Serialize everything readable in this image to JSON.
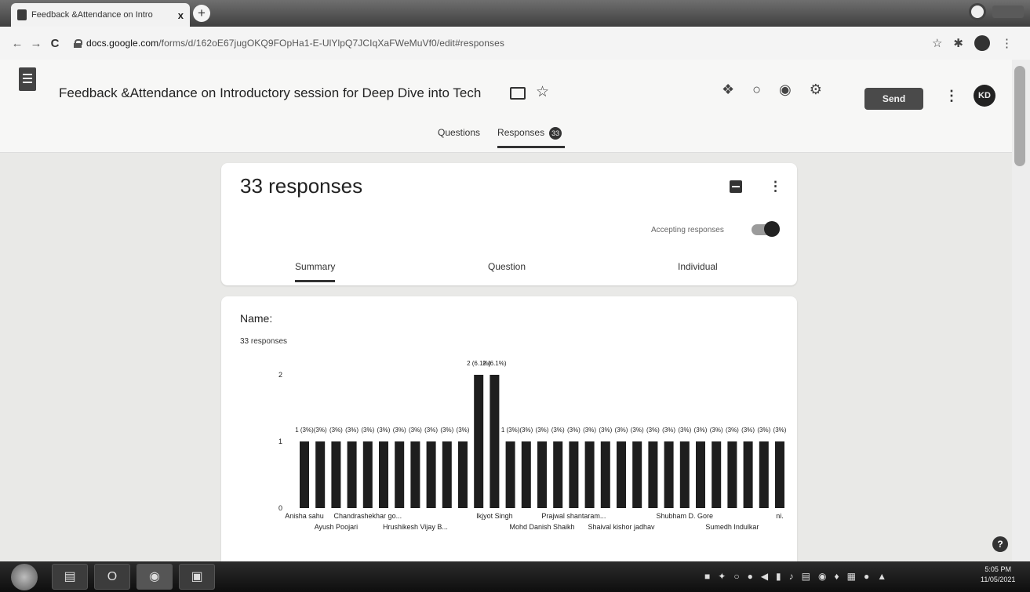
{
  "browser": {
    "tab_title": "Feedback &Attendance on Intro",
    "tab_close": "x",
    "new_tab": "+",
    "url_host": "docs.google.com",
    "url_path": "/forms/d/162oE67jugOKQ9FOpHa1-E-UlYlpQ7JCIqXaFWeMuVf0/edit#responses"
  },
  "header": {
    "title": "Feedback &Attendance  on Introductory session for  Deep Dive into Tech",
    "send_label": "Send",
    "avatar_initials": "KD"
  },
  "main_tabs": {
    "questions": "Questions",
    "responses": "Responses",
    "responses_count": "33"
  },
  "summary_card": {
    "response_count_title": "33 responses",
    "accepting_label": "Accepting responses",
    "accepting": true,
    "tabs": {
      "summary": "Summary",
      "question": "Question",
      "individual": "Individual"
    }
  },
  "question_card": {
    "title": "Name:",
    "count": "33 responses"
  },
  "chart_data": {
    "type": "bar",
    "title": "",
    "ylim": [
      0,
      2
    ],
    "yticks": [
      0,
      1,
      2
    ],
    "values": [
      1,
      1,
      1,
      1,
      1,
      1,
      1,
      1,
      1,
      1,
      1,
      2,
      2,
      1,
      1,
      1,
      1,
      1,
      1,
      1,
      1,
      1,
      1,
      1,
      1,
      1,
      1,
      1,
      1,
      1,
      1
    ],
    "value_labels": [
      "1 (3%)",
      "(3%)",
      "(3%)",
      "(3%)",
      "(3%)",
      "(3%)",
      "(3%)",
      "(3%)",
      "(3%)",
      "(3%)",
      "(3%)",
      "2 (6.1%)",
      "2 (6.1%)",
      "1 (3%)",
      "(3%)",
      "(3%)",
      "(3%)",
      "(3%)",
      "(3%)",
      "(3%)",
      "(3%)",
      "(3%)",
      "(3%)",
      "(3%)",
      "(3%)",
      "(3%)",
      "(3%)",
      "(3%)",
      "(3%)",
      "(3%)",
      "(3%)"
    ],
    "x_labels": [
      {
        "bar": 0,
        "text": "Anisha sahu",
        "row": 1
      },
      {
        "bar": 2,
        "text": "Ayush Poojari",
        "row": 2
      },
      {
        "bar": 4,
        "text": "Chandrashekhar go...",
        "row": 1
      },
      {
        "bar": 7,
        "text": "Hrushikesh Vijay B...",
        "row": 2
      },
      {
        "bar": 12,
        "text": "Ikjyot Singh",
        "row": 1
      },
      {
        "bar": 15,
        "text": "Mohd Danish Shaikh",
        "row": 2
      },
      {
        "bar": 17,
        "text": "Prajwal shantaram...",
        "row": 1
      },
      {
        "bar": 20,
        "text": "Shaival kishor jadhav",
        "row": 2
      },
      {
        "bar": 24,
        "text": "Shubham D. Gore",
        "row": 1
      },
      {
        "bar": 27,
        "text": "Sumedh Indulkar",
        "row": 2
      },
      {
        "bar": 30,
        "text": "ni.",
        "row": 1
      }
    ],
    "bar_color": "#1e1e1e"
  },
  "taskbar": {
    "time": "5:05 PM",
    "date": "11/05/2021"
  }
}
